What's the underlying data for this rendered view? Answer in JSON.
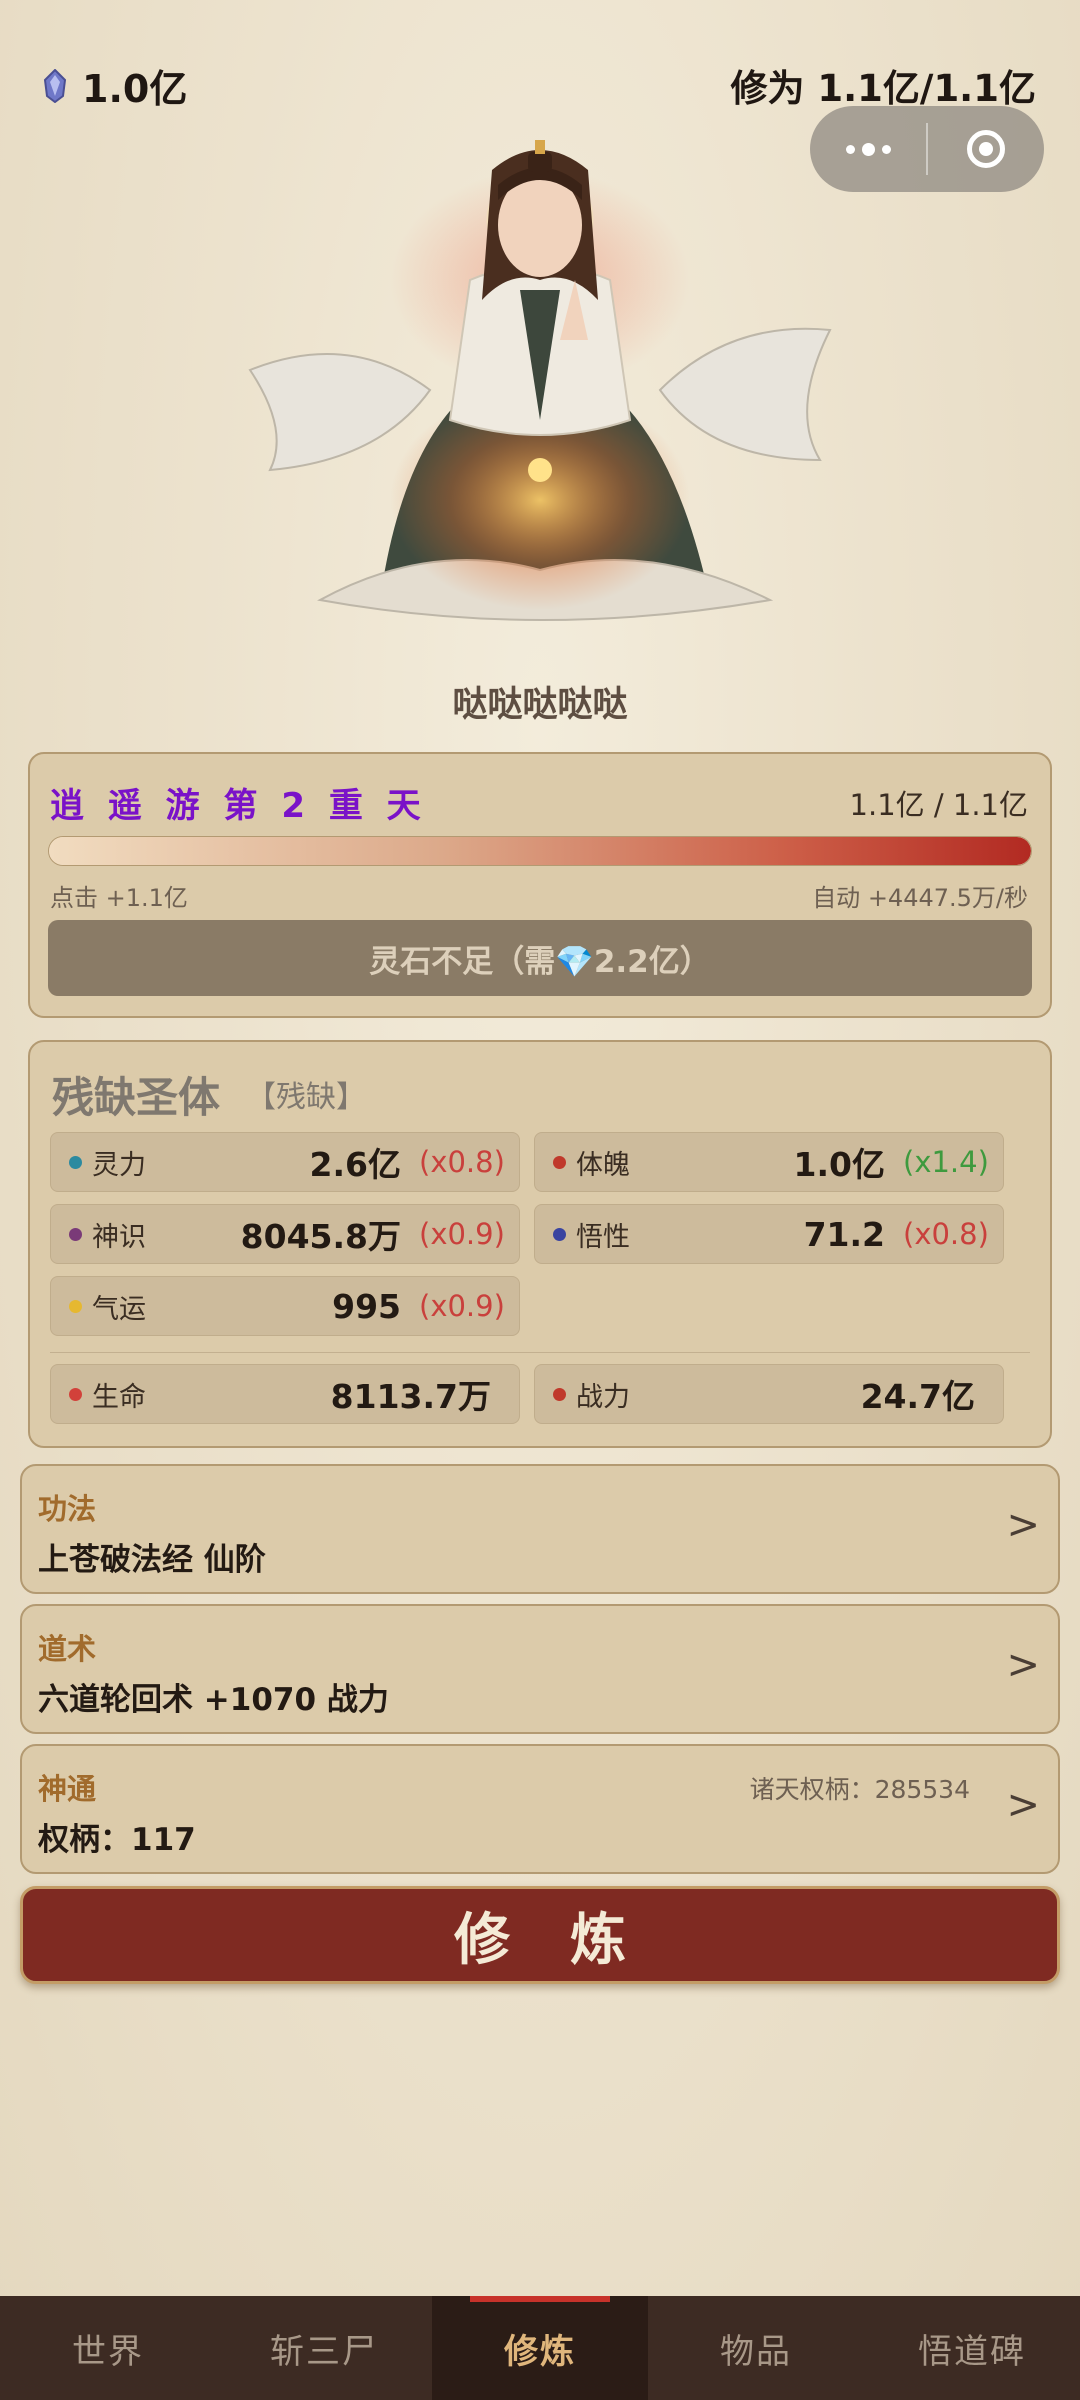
{
  "header": {
    "spirit_stones": "1.0亿",
    "cultivation_label": "修为 1.1亿/1.1亿"
  },
  "capsule": {
    "more_icon": "more-dots-icon",
    "close_icon": "target-ring-icon"
  },
  "hero": {
    "name": "哒哒哒哒哒"
  },
  "realm": {
    "title": "逍 遥 游   第 2 重 天",
    "progress_text": "1.1亿 / 1.1亿",
    "progress_fraction": 1.0,
    "click_gain": "点击 +1.1亿",
    "auto_gain": "自动 +4447.5万/秒",
    "breakthrough_button": "灵石不足（需💎2.2亿）"
  },
  "body_type": {
    "title": "残缺圣体",
    "tag": "【残缺】",
    "stats": [
      {
        "label": "灵力",
        "value": "2.6亿",
        "mult": "(x0.8)",
        "dot": "#2b8aa0",
        "mult_color": "red"
      },
      {
        "label": "体魄",
        "value": "1.0亿",
        "mult": "(x1.4)",
        "dot": "#c0392b",
        "mult_color": "green"
      },
      {
        "label": "神识",
        "value": "8045.8万",
        "mult": "(x0.9)",
        "dot": "#7a3a78",
        "mult_color": "red"
      },
      {
        "label": "悟性",
        "value": "71.2",
        "mult": "(x0.8)",
        "dot": "#3a44a0",
        "mult_color": "red"
      },
      {
        "label": "气运",
        "value": "995",
        "mult": "(x0.9)",
        "dot": "#e6b830",
        "mult_color": "red"
      }
    ],
    "derived": [
      {
        "label": "生命",
        "value": "8113.7万",
        "dot": "#d2413a"
      },
      {
        "label": "战力",
        "value": "24.7亿",
        "dot": "#c0392b"
      }
    ]
  },
  "technique": {
    "category": "功法",
    "main": "上苍破法经  仙阶",
    "chevron": ">"
  },
  "dao_art": {
    "category": "道术",
    "main": "六道轮回术  +1070 战力",
    "chevron": ">"
  },
  "divine": {
    "category": "神通",
    "main": "权柄：117",
    "extra": "诸天权柄：285534",
    "chevron": ">"
  },
  "cultivate_button": "修炼",
  "tabs": [
    {
      "label": "世界"
    },
    {
      "label": "斩三尸"
    },
    {
      "label": "修炼",
      "active": true
    },
    {
      "label": "物品"
    },
    {
      "label": "悟道碑"
    }
  ]
}
